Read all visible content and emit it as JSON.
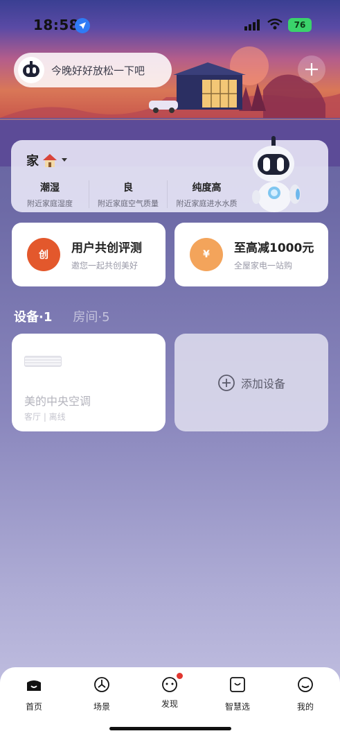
{
  "status_bar": {
    "time": "18:58",
    "battery": "76"
  },
  "header": {
    "greeting": "今晚好好放松一下吧"
  },
  "home": {
    "title": "家",
    "stats": [
      {
        "value": "潮湿",
        "label": "附近家庭湿度"
      },
      {
        "value": "良",
        "label": "附近家庭空气质量"
      },
      {
        "value": "纯度高",
        "label": "附近家庭进水水质"
      }
    ]
  },
  "promos": [
    {
      "title": "用户共创评测",
      "subtitle": "邀您一起共创美好",
      "icon_text": "创",
      "icon": "review-badge-icon",
      "color": "#e3582c"
    },
    {
      "title": "至高减1000元",
      "subtitle": "全屋家电一站购",
      "icon_text": "¥",
      "icon": "coupon-icon",
      "color": "#f3a45b"
    }
  ],
  "tabs": {
    "devices": "设备·1",
    "rooms": "房间·5"
  },
  "device": {
    "name": "美的中央空调",
    "room_status": "客厅 | 离线"
  },
  "add_device": {
    "label": "添加设备"
  },
  "nav": [
    {
      "label": "首页",
      "icon": "home-icon",
      "active": true
    },
    {
      "label": "场景",
      "icon": "scene-icon"
    },
    {
      "label": "发现",
      "icon": "discover-icon",
      "badge": true
    },
    {
      "label": "智慧选",
      "icon": "shop-icon"
    },
    {
      "label": "我的",
      "icon": "profile-icon"
    }
  ],
  "colors": {
    "accent_red": "#e1362f",
    "battery": "#3ad36b",
    "location": "#2f7bf5"
  }
}
